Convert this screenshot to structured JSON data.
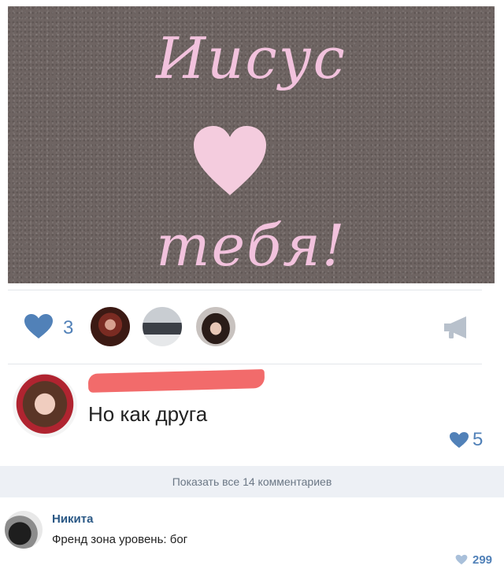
{
  "post": {
    "photo_text": {
      "line1": "Иисус",
      "line3": "тебя!"
    },
    "likes": {
      "count": "3"
    },
    "colors": {
      "accent": "#5181b8",
      "heart_photo": "#f2c2dd",
      "redaction": "#f26b6b"
    }
  },
  "comments": [
    {
      "author_redacted": true,
      "text": "Но как друга",
      "likes": "5"
    }
  ],
  "show_all_comments": "Показать все 14 комментариев",
  "reply": {
    "author": "Никита",
    "text": "Френд зона уровень: бог",
    "likes": "299"
  }
}
